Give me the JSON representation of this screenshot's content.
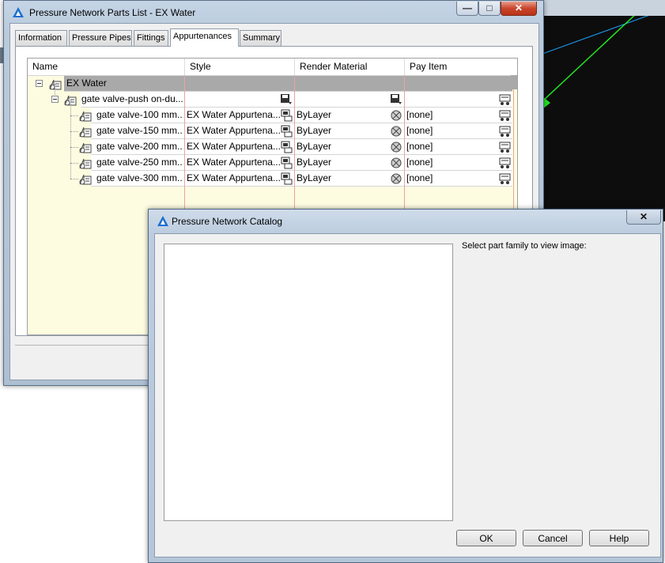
{
  "parts_list_window": {
    "title": "Pressure Network Parts List - EX Water",
    "minimize_symbol": "—",
    "maximize_symbol": "□",
    "close_symbol": "✕",
    "tabs": [
      {
        "label": "Information"
      },
      {
        "label": "Pressure Pipes"
      },
      {
        "label": "Fittings"
      },
      {
        "label": "Appurtenances"
      },
      {
        "label": "Summary"
      }
    ],
    "active_tab": "Appurtenances",
    "columns": [
      "Name",
      "Style",
      "Render Material",
      "Pay Item"
    ],
    "root": {
      "name": "EX Water"
    },
    "family": {
      "name": "gate valve-push on-du..."
    },
    "rows": [
      {
        "name": "gate valve-100 mm...",
        "style": "EX Water Appurtena...",
        "render_material": "ByLayer",
        "pay_item": "[none]"
      },
      {
        "name": "gate valve-150 mm...",
        "style": "EX Water Appurtena...",
        "render_material": "ByLayer",
        "pay_item": "[none]"
      },
      {
        "name": "gate valve-200 mm...",
        "style": "EX Water Appurtena...",
        "render_material": "ByLayer",
        "pay_item": "[none]"
      },
      {
        "name": "gate valve-250 mm...",
        "style": "EX Water Appurtena...",
        "render_material": "ByLayer",
        "pay_item": "[none]"
      },
      {
        "name": "gate valve-300 mm...",
        "style": "EX Water Appurtena...",
        "render_material": "ByLayer",
        "pay_item": "[none]"
      }
    ]
  },
  "catalog_dialog": {
    "title": "Pressure Network Catalog",
    "close_symbol": "✕",
    "prompt": "Select part family to view image:",
    "buttons": {
      "ok": "OK",
      "cancel": "Cancel",
      "help": "Help"
    }
  },
  "colors": {
    "titlebar": "#c5d5e6",
    "selected_row": "#a9a9a9",
    "grid_background": "#fdfbe0",
    "column_divider": "#e8a4a4",
    "close_button": "#c9452c",
    "cad_background": "#0d0d0d"
  }
}
